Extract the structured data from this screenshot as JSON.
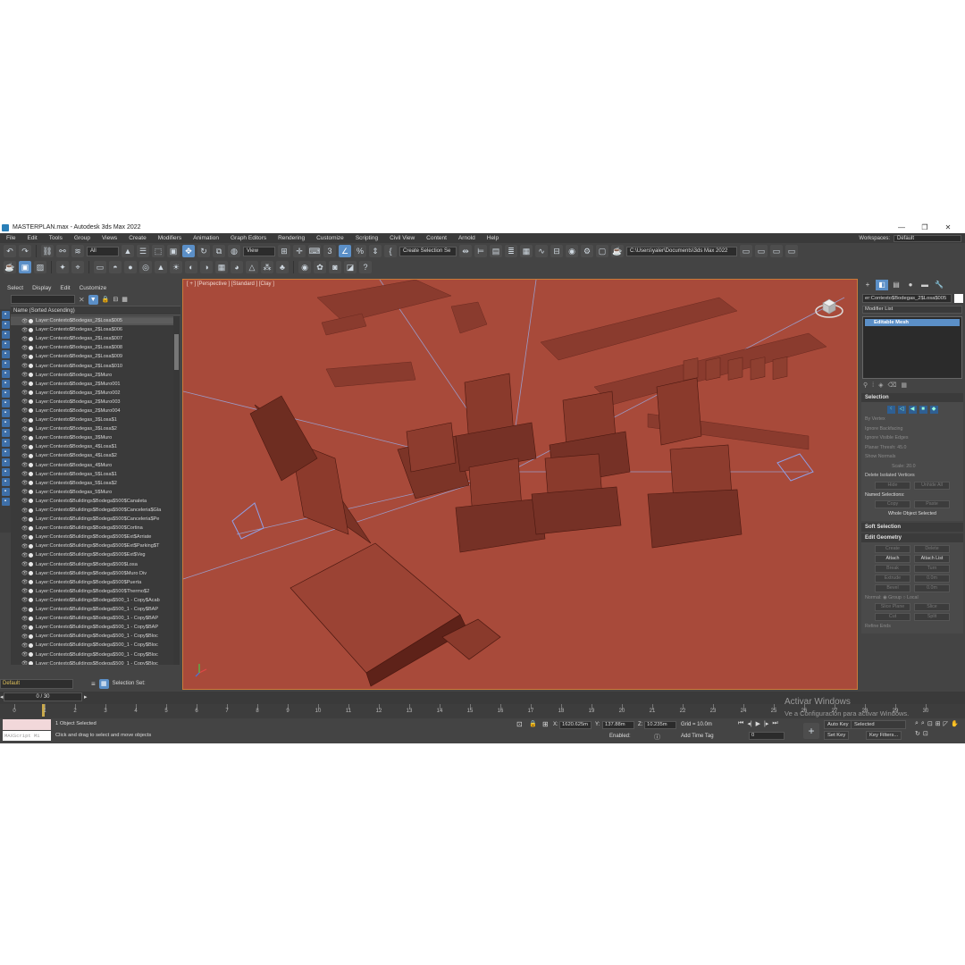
{
  "window": {
    "title": "MASTERPLAN.max - Autodesk 3ds Max 2022",
    "controls": [
      "—",
      "❐",
      "✕"
    ]
  },
  "menu": [
    "File",
    "Edit",
    "Tools",
    "Group",
    "Views",
    "Create",
    "Modifiers",
    "Animation",
    "Graph Editors",
    "Rendering",
    "Customize",
    "Scripting",
    "Civil View",
    "Content",
    "Arnold",
    "Help"
  ],
  "workspaces": {
    "label": "Workspaces:",
    "value": "Default"
  },
  "toolbar": {
    "filter_value": "All",
    "view_value": "View",
    "selection_set": "Create Selection Se",
    "path": "C:\\Users\\yaler\\Documents\\3ds Max 2022"
  },
  "scene_explorer": {
    "menu": [
      "Select",
      "Display",
      "Edit",
      "Customize"
    ],
    "column_header": "Name (Sorted Ascending)",
    "rows": [
      "Layer:Contexto$Bodegas_2$Losa$005",
      "Layer:Contexto$Bodegas_2$Losa$006",
      "Layer:Contexto$Bodegas_2$Losa$007",
      "Layer:Contexto$Bodegas_2$Losa$008",
      "Layer:Contexto$Bodegas_2$Losa$009",
      "Layer:Contexto$Bodegas_2$Losa$010",
      "Layer:Contexto$Bodegas_2$Muro",
      "Layer:Contexto$Bodegas_2$Muro001",
      "Layer:Contexto$Bodegas_2$Muro002",
      "Layer:Contexto$Bodegas_2$Muro003",
      "Layer:Contexto$Bodegas_2$Muro004",
      "Layer:Contexto$Bodegas_3$Losa$1",
      "Layer:Contexto$Bodegas_3$Losa$2",
      "Layer:Contexto$Bodegas_3$Muro",
      "Layer:Contexto$Bodegas_4$Losa$1",
      "Layer:Contexto$Bodegas_4$Losa$2",
      "Layer:Contexto$Bodegas_4$Muro",
      "Layer:Contexto$Bodegas_5$Losa$1",
      "Layer:Contexto$Bodegas_5$Losa$2",
      "Layer:Contexto$Bodegas_5$Muro",
      "Layer:Contexto$Buildings$Bodega$500$Canaleta",
      "Layer:Contexto$Buildings$Bodega$500$Canceleria$Gla",
      "Layer:Contexto$Buildings$Bodega$500$Canceleria$Pe",
      "Layer:Contexto$Buildings$Bodega$500$Cortina",
      "Layer:Contexto$Buildings$Bodega$500$Ext$Arriate",
      "Layer:Contexto$Buildings$Bodega$500$Ext$Parking$T",
      "Layer:Contexto$Buildings$Bodega$500$Ext$Veg",
      "Layer:Contexto$Buildings$Bodega$500$Losa",
      "Layer:Contexto$Buildings$Bodega$500$Muro Div",
      "Layer:Contexto$Buildings$Bodega$500$Puerta",
      "Layer:Contexto$Buildings$Bodega$500$Thermo$2",
      "Layer:Contexto$Buildings$Bodega$500_1 - Copy$Acab",
      "Layer:Contexto$Buildings$Bodega$500_1 - Copy$BAP",
      "Layer:Contexto$Buildings$Bodega$500_1 - Copy$BAP",
      "Layer:Contexto$Buildings$Bodega$500_1 - Copy$BAP",
      "Layer:Contexto$Buildings$Bodega$500_1 - Copy$Bloc",
      "Layer:Contexto$Buildings$Bodega$500_1 - Copy$Bloc",
      "Layer:Contexto$Buildings$Bodega$500_1 - Copy$Bloc",
      "Layer:Contexto$Buildings$Bodega$500_1 - Copy$Bloc"
    ],
    "layer_value": "Default",
    "selection_set_label": "Selection Set:"
  },
  "viewport": {
    "label": "[ + ] [Perspective ] [Standard ] [Clay ]",
    "background": "#a84a3a"
  },
  "command_panel": {
    "object_name": "er:Contexto$Bodegas_2$Losa$005",
    "modifier_list": "Modifier List",
    "stack_item": "Editable Mesh",
    "selection": {
      "title": "Selection",
      "by_vertex": "By Vertex",
      "ignore_backfacing": "Ignore Backfacing",
      "ignore_visible_edges": "Ignore Visible Edges",
      "planar_thresh_label": "Planar Thresh:",
      "planar_thresh": "45.0",
      "show_normals": "Show Normals",
      "scale_label": "Scale:",
      "scale": "20.0",
      "delete_isolated": "Delete Isolated Vertices",
      "hide": "Hide",
      "unhide_all": "Unhide All",
      "named_selections": "Named Selections:",
      "copy": "Copy",
      "paste": "Paste",
      "whole_object": "Whole Object Selected"
    },
    "soft_selection": "Soft Selection",
    "edit_geometry": {
      "title": "Edit Geometry",
      "create": "Create",
      "delete": "Delete",
      "attach": "Attach",
      "attach_list": "Attach List",
      "break": "Break",
      "turn": "Turn",
      "extrude": "Extrude",
      "extrude_val": "0.0m",
      "bevel": "Bevel",
      "bevel_val": "0.0m",
      "normal_label": "Normal:",
      "group": "Group",
      "local": "Local",
      "slice_plane": "Slice Plane",
      "slice": "Slice",
      "cut": "Cut",
      "split": "Split",
      "refine_ends": "Refine Ends"
    }
  },
  "timeline": {
    "slider": "0 / 30",
    "frames": [
      "0",
      "1",
      "2",
      "3",
      "4",
      "5",
      "6",
      "7",
      "8",
      "9",
      "10",
      "11",
      "12",
      "13",
      "14",
      "15",
      "16",
      "17",
      "18",
      "19",
      "20",
      "21",
      "22",
      "23",
      "24",
      "25",
      "26",
      "27",
      "28",
      "29",
      "30"
    ]
  },
  "status": {
    "maxscript": "MAXScript Mi",
    "selected": "1 Object Selected",
    "prompt": "Click and drag to select and move objects",
    "x_label": "X:",
    "x": "1620.625m",
    "y_label": "Y:",
    "y": "137.88m",
    "z_label": "Z:",
    "z": "10.235m",
    "grid": "Grid = 10.0m",
    "enabled": "Enabled:",
    "add_time_tag": "Add Time Tag",
    "frame": "0",
    "auto_key": "Auto Key",
    "key_mode": "Selected",
    "set_key": "Set Key",
    "key_filters": "Key Filters..."
  },
  "watermark": {
    "line1": "Activar Windows",
    "line2": "Ve a Configuración para activar Windows."
  }
}
